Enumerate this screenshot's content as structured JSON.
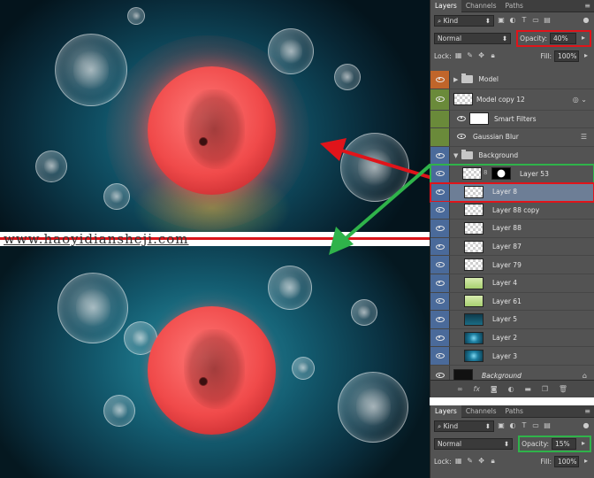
{
  "watermark": "www.haoyidiansheji.com",
  "colors": {
    "highlight_red": "#e0141a",
    "highlight_green": "#2fb34a",
    "selection": "#6d7e96"
  },
  "panel_top": {
    "tabs": [
      "Layers",
      "Channels",
      "Paths"
    ],
    "filter_kind": "Kind",
    "blend_mode": "Normal",
    "opacity_label": "Opacity:",
    "opacity_value": "40%",
    "lock_label": "Lock:",
    "fill_label": "Fill:",
    "fill_value": "100%",
    "layers": [
      {
        "name": "Model",
        "kind": "group",
        "eye": "orange"
      },
      {
        "name": "Model copy 12",
        "kind": "smart",
        "eye": "green"
      },
      {
        "name": "Smart Filters",
        "kind": "filters",
        "eye": "green"
      },
      {
        "name": "Gaussian Blur",
        "kind": "filter",
        "eye": "green"
      },
      {
        "name": "Background",
        "kind": "group-open",
        "eye": "blue"
      },
      {
        "name": "Layer 53",
        "kind": "masked",
        "eye": "blue"
      },
      {
        "name": "Layer 8",
        "kind": "selected",
        "eye": "blue"
      },
      {
        "name": "Layer 88 copy",
        "kind": "layer",
        "eye": "blue"
      },
      {
        "name": "Layer 88",
        "kind": "layer",
        "eye": "blue"
      },
      {
        "name": "Layer 87",
        "kind": "layer",
        "eye": "blue"
      },
      {
        "name": "Layer 79",
        "kind": "layer",
        "eye": "blue"
      },
      {
        "name": "Layer 4",
        "kind": "layer-green",
        "eye": "blue"
      },
      {
        "name": "Layer 61",
        "kind": "layer-green",
        "eye": "blue"
      },
      {
        "name": "Layer 5",
        "kind": "dark",
        "eye": "blue"
      },
      {
        "name": "Layer 2",
        "kind": "blue",
        "eye": "blue"
      },
      {
        "name": "Layer 3",
        "kind": "blue",
        "eye": "blue"
      },
      {
        "name": "Background",
        "kind": "background",
        "eye": "none"
      }
    ],
    "footer_icons": [
      "link-icon",
      "fx-icon",
      "mask-icon",
      "adjustment-icon",
      "folder-icon",
      "new-layer-icon",
      "trash-icon"
    ]
  },
  "panel_bottom": {
    "tabs": [
      "Layers",
      "Channels",
      "Paths"
    ],
    "filter_kind": "Kind",
    "blend_mode": "Normal",
    "opacity_label": "Opacity:",
    "opacity_value": "15%",
    "lock_label": "Lock:",
    "fill_label": "Fill:",
    "fill_value": "100%"
  }
}
